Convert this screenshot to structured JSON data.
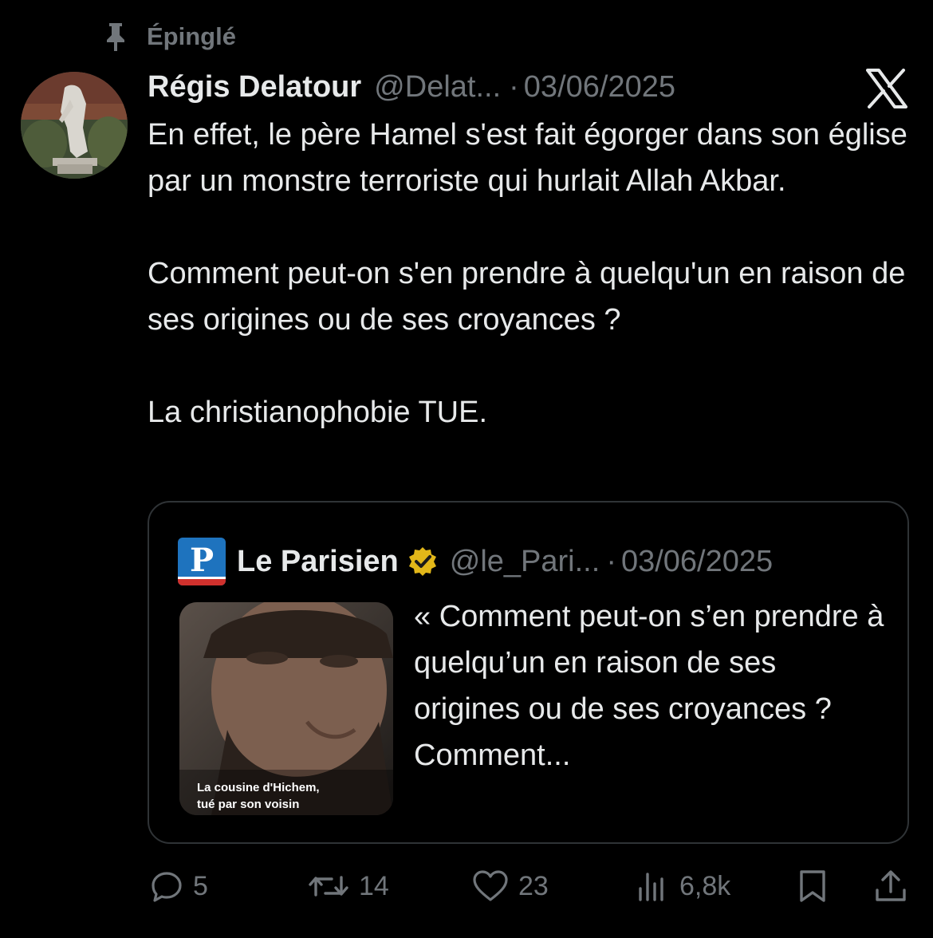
{
  "pinned": {
    "label": "Épinglé"
  },
  "tweet": {
    "author_name": "Régis Delatour",
    "author_handle": "@Delat...",
    "separator": "·",
    "date": "03/06/2025",
    "text": [
      "En effet, le père Hamel s'est fait égorger dans son église par un monstre terroriste qui hurlait Allah Akbar.",
      "Comment peut-on s'en prendre à quelqu'un en raison de ses origines ou de ses croyances ?",
      "La christianophobie TUE."
    ]
  },
  "quote": {
    "logo_letter": "P",
    "author_name": "Le Parisien",
    "author_handle": "@le_Pari...",
    "separator": "·",
    "date": "03/06/2025",
    "text": "« Comment peut-on s’en prendre à quelqu’un en raison de ses origines ou de ses croyances ?  Comment...",
    "thumbnail_caption_line1": "La cousine d'Hichem,",
    "thumbnail_caption_line2": "tué par son voisin"
  },
  "actions": {
    "replies": "5",
    "reposts": "14",
    "likes": "23",
    "views": "6,8k"
  },
  "colors": {
    "background": "#000000",
    "text": "#e7e9ea",
    "muted": "#71767b",
    "border": "#2f3336",
    "verified_gold": "#e2b719",
    "parisien_blue": "#1e73be",
    "parisien_red": "#d0312d"
  },
  "icons": {
    "pin": "pin-icon",
    "x_logo": "x-logo-icon",
    "verified": "verified-badge-icon",
    "reply": "reply-icon",
    "repost": "repost-icon",
    "like": "heart-icon",
    "views": "views-icon",
    "bookmark": "bookmark-icon",
    "share": "share-icon"
  }
}
